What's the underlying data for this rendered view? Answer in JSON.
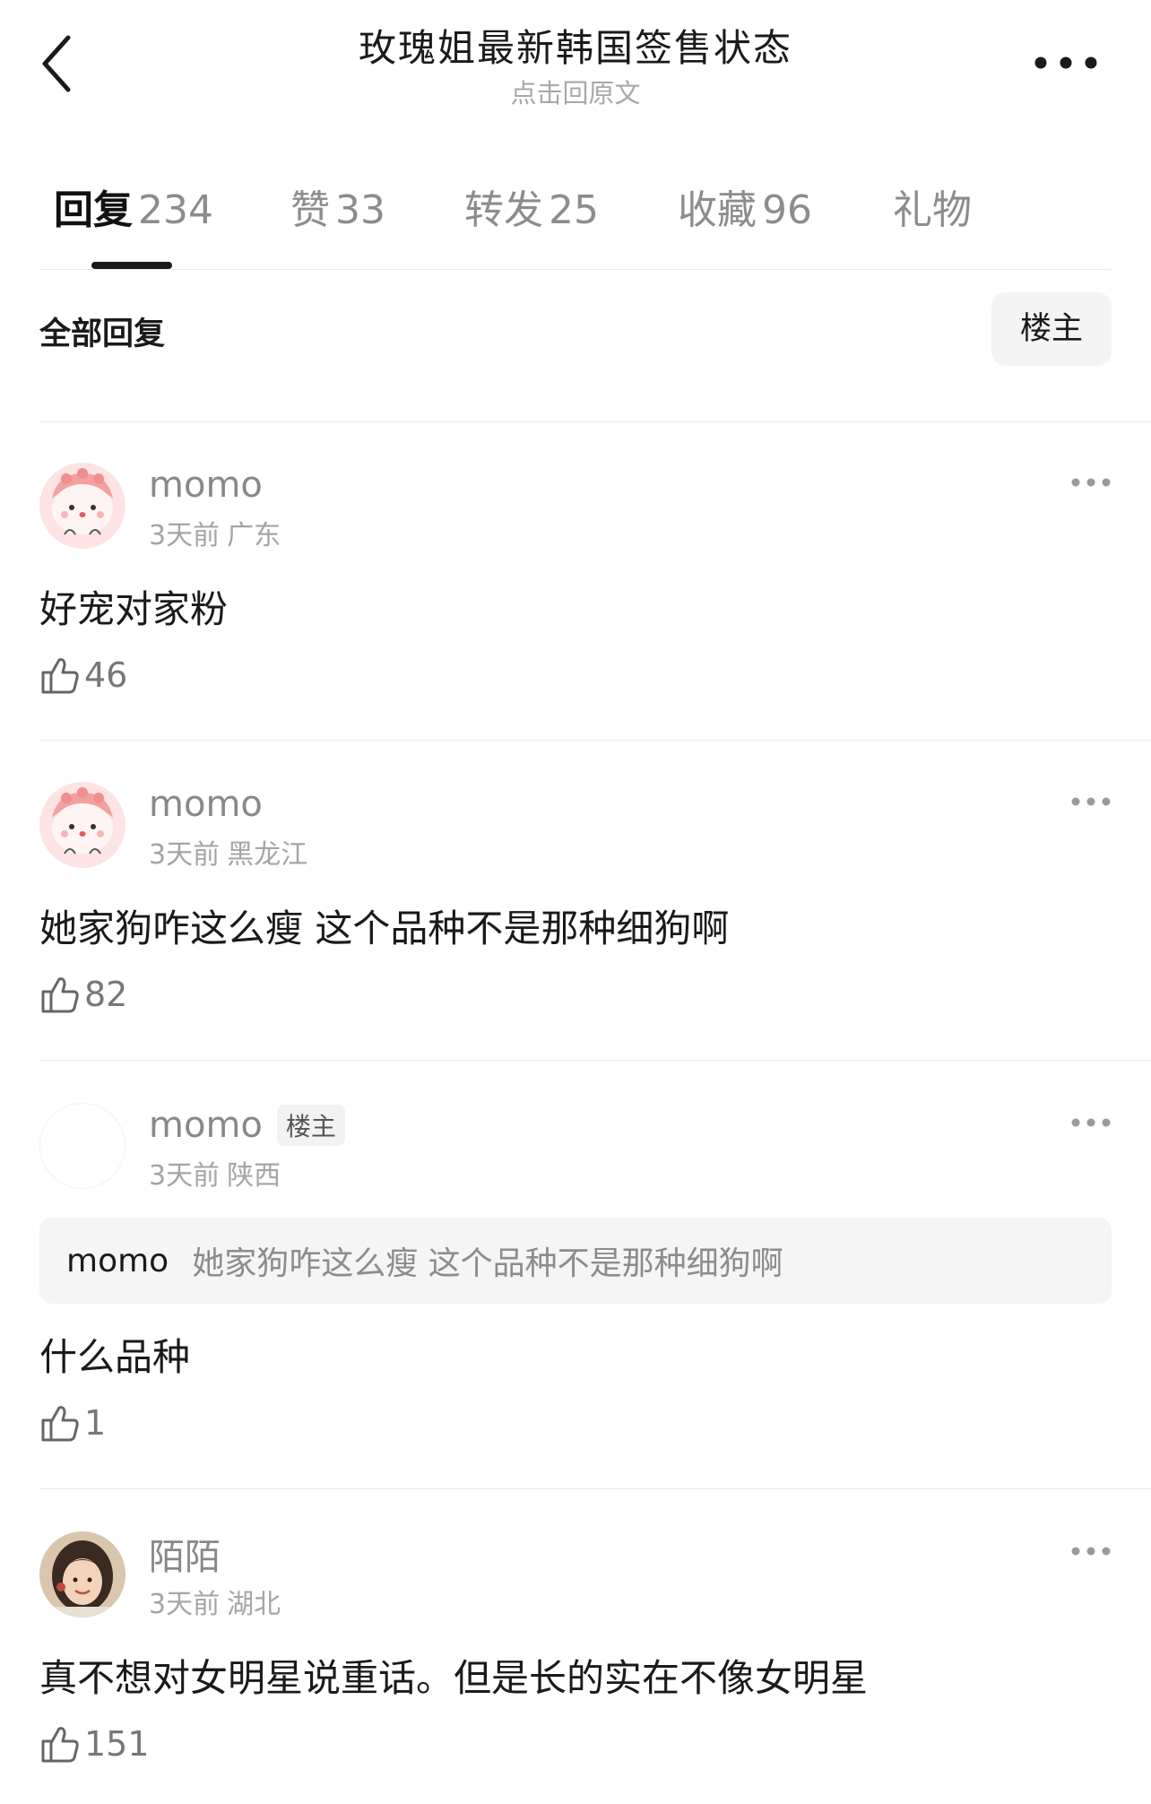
{
  "header": {
    "title": "玫瑰姐最新韩国签售状态",
    "subtitle": "点击回原文"
  },
  "tabs": [
    {
      "label": "回复",
      "count": "234"
    },
    {
      "label": "赞",
      "count": "33"
    },
    {
      "label": "转发",
      "count": "25"
    },
    {
      "label": "收藏",
      "count": "96"
    },
    {
      "label": "礼物",
      "count": ""
    }
  ],
  "filter": {
    "label": "全部回复",
    "owner_button": "楼主"
  },
  "comments": [
    {
      "username": "momo",
      "time": "3天前",
      "location": "广东",
      "text": "好宠对家粉",
      "likes": "46"
    },
    {
      "username": "momo",
      "time": "3天前",
      "location": "黑龙江",
      "text": "她家狗咋这么瘦 这个品种不是那种细狗啊",
      "likes": "82"
    },
    {
      "username": "momo",
      "badge": "楼主",
      "time": "3天前",
      "location": "陕西",
      "quote": {
        "user": "momo",
        "text": "她家狗咋这么瘦 这个品种不是那种细狗啊"
      },
      "text": "什么品种",
      "likes": "1"
    },
    {
      "username": "陌陌",
      "time": "3天前",
      "location": "湖北",
      "text": "真不想对女明星说重话。但是长的实在不像女明星",
      "likes": "151"
    }
  ],
  "icons": {
    "back": "chevron-left-icon",
    "more": "ellipsis-icon",
    "like": "thumb-up-icon"
  }
}
